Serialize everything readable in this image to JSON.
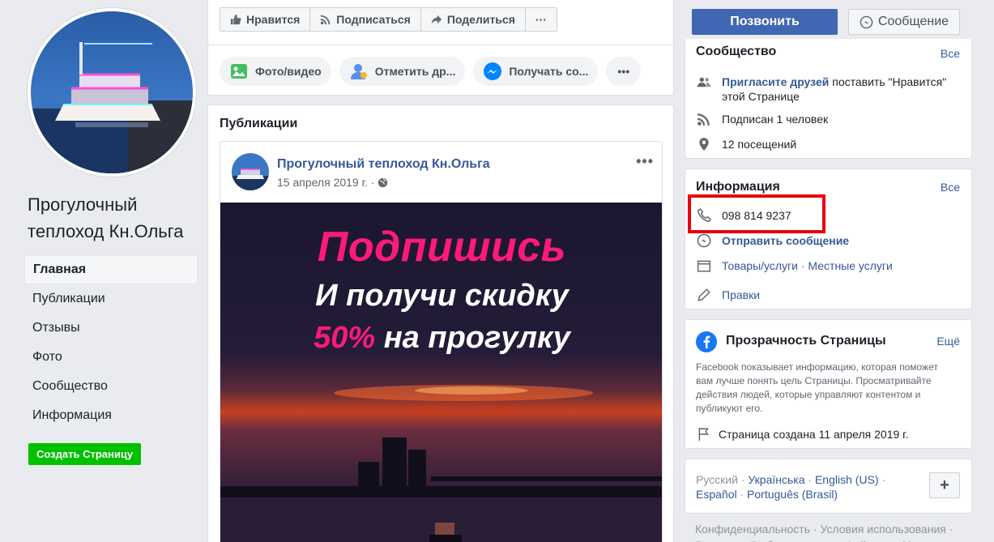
{
  "page": {
    "name": "Прогулочный теплоход Кн.Ольга",
    "create_page": "Создать Страницу"
  },
  "nav": [
    {
      "label": "Главная",
      "active": true
    },
    {
      "label": "Публикации"
    },
    {
      "label": "Отзывы"
    },
    {
      "label": "Фото"
    },
    {
      "label": "Сообщество"
    },
    {
      "label": "Информация"
    }
  ],
  "actions": {
    "like": "Нравится",
    "follow": "Подписаться",
    "share": "Поделиться",
    "more": "···"
  },
  "composer": {
    "photo": "Фото/видео",
    "tag": "Отметить др...",
    "get": "Получать со...",
    "more": "•••"
  },
  "cta": {
    "call": "Позвонить",
    "message": "Сообщение"
  },
  "posts": {
    "title": "Публикации",
    "author": "Прогулочный теплоход Кн.Ольга",
    "date": "15 апреля 2019 г. ·",
    "more": "•••",
    "image_line1": "Подпишись",
    "image_line2": "И получи скидку",
    "image_line3_pct": "50%",
    "image_line3_rest": " на прогулку"
  },
  "community": {
    "title": "Сообщество",
    "all": "Все",
    "invite_link": "Пригласите друзей",
    "invite_rest": " поставить \"Нравится\" этой Странице",
    "followers": "Подписан 1 человек",
    "visits": "12 посещений"
  },
  "info": {
    "title": "Информация",
    "all": "Все",
    "phone": "098 814 9237",
    "send_message": "Отправить сообщение",
    "categories": "Товары/услуги · Местные услуги",
    "edits": "Правки"
  },
  "transparency": {
    "title": "Прозрачность Страницы",
    "more": "Ещё",
    "description": "Facebook показывает информацию, которая поможет вам лучше понять цель Страницы. Просматривайте действия людей, которые управляют контентом и публикуют его.",
    "created": "Страница создана 11 апреля 2019 г."
  },
  "languages": {
    "current": "Русский",
    "sep": " · ",
    "list": [
      "Українська",
      "English (US)",
      "Español",
      "Português (Brasil)"
    ],
    "plus": "+"
  },
  "footer": {
    "links": "Конфиденциальность · Условия использования · Реклама · Выбор рекламы · Файлы cookie"
  },
  "colors": {
    "brand_blue": "#4267b2",
    "link": "#365899",
    "create_green": "#00c100",
    "highlight_red": "#e8000b",
    "promo_pink": "#ff1a7a"
  }
}
